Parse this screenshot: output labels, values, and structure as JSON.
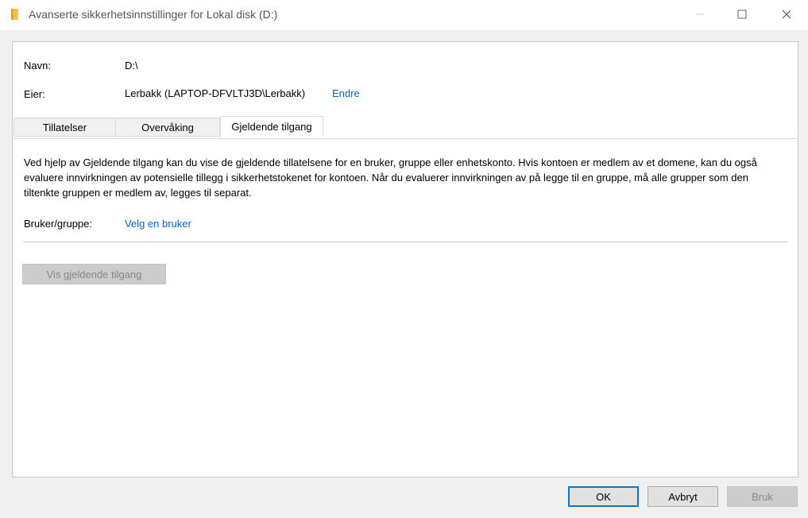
{
  "window": {
    "title": "Avanserte sikkerhetsinnstillinger for Lokal disk (D:)",
    "controls": [
      "minimize-icon",
      "maximize-icon",
      "close-icon"
    ]
  },
  "info": {
    "name_label": "Navn:",
    "name_value": "D:\\",
    "owner_label": "Eier:",
    "owner_value": "Lerbakk (LAPTOP-DFVLTJ3D\\Lerbakk)",
    "owner_change_link": "Endre"
  },
  "tabs": [
    {
      "label": "Tillatelser",
      "active": false
    },
    {
      "label": "Overvåking",
      "active": false
    },
    {
      "label": "Gjeldende tilgang",
      "active": true
    }
  ],
  "effective_access": {
    "description": "Ved hjelp av Gjeldende tilgang kan du vise de gjeldende tillatelsene for en bruker, gruppe eller enhetskonto. Hvis kontoen er medlem av et domene, kan du også evaluere innvirkningen av potensielle tillegg i sikkerhetstokenet for kontoen. Når du evaluerer innvirkningen av på legge til en gruppe, må alle grupper som den tiltenkte gruppen er medlem av, legges til separat.",
    "user_group_label": "Bruker/gruppe:",
    "select_user_link": "Velg en bruker",
    "view_button": "Vis gjeldende tilgang"
  },
  "footer": {
    "ok": "OK",
    "cancel": "Avbryt",
    "apply": "Bruk"
  },
  "colors": {
    "link": "#0066cc",
    "accent": "#0078d7",
    "folder": "#f5c342"
  }
}
